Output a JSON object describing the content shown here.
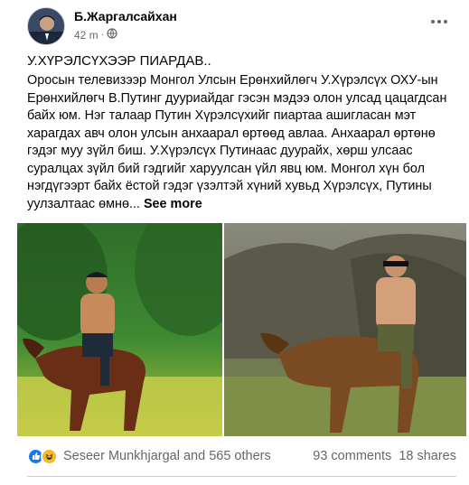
{
  "post": {
    "author": "Б.Жаргалсайхан",
    "time": "42 m",
    "separator": "·",
    "privacy_icon": "globe-icon",
    "menu_icon": "more-horizontal-icon",
    "headline": "У.ХҮРЭЛСҮХЭЭР ПИАРДАВ..",
    "body": "Оросын телевизээр Монгол Улсын Ерөнхийлөгч У.Хүрэлсүх ОХУ-ын Ерөнхийлөгч В.Путинг дууриайдаг гэсэн мэдээ олон улсад цацагдсан байх юм. Нэг талаар Путин Хүрэлсүхийг пиартаа ашигласан мэт харагдах авч олон улсын анхаарал өртөөд авлаа. Анхаарал өртөнө гэдэг муу зүйл биш. У.Хүрэлсүх Путинаас дуурайх, хөрш улсаас суралцах зүйл бий гэдгийг харуулсан үйл явц юм. Монгол хүн бол нэгдүгээрт байх ёстой гэдэг үзэлтэй хүний хувьд Хүрэлсүх, Путины уулзалтаас өмнө...",
    "see_more": "See more"
  },
  "stats": {
    "reactions_icons": [
      "like-reaction-icon",
      "haha-reaction-icon"
    ],
    "reactions_text": "Seseer Munkhjargal and 565 others",
    "comments": "93 comments",
    "shares": "18 shares"
  },
  "colors": {
    "text": "#050505",
    "secondary": "#65676b",
    "like_blue": "#1877f2",
    "haha_yellow": "#f7b928",
    "divider": "#ced0d4"
  }
}
